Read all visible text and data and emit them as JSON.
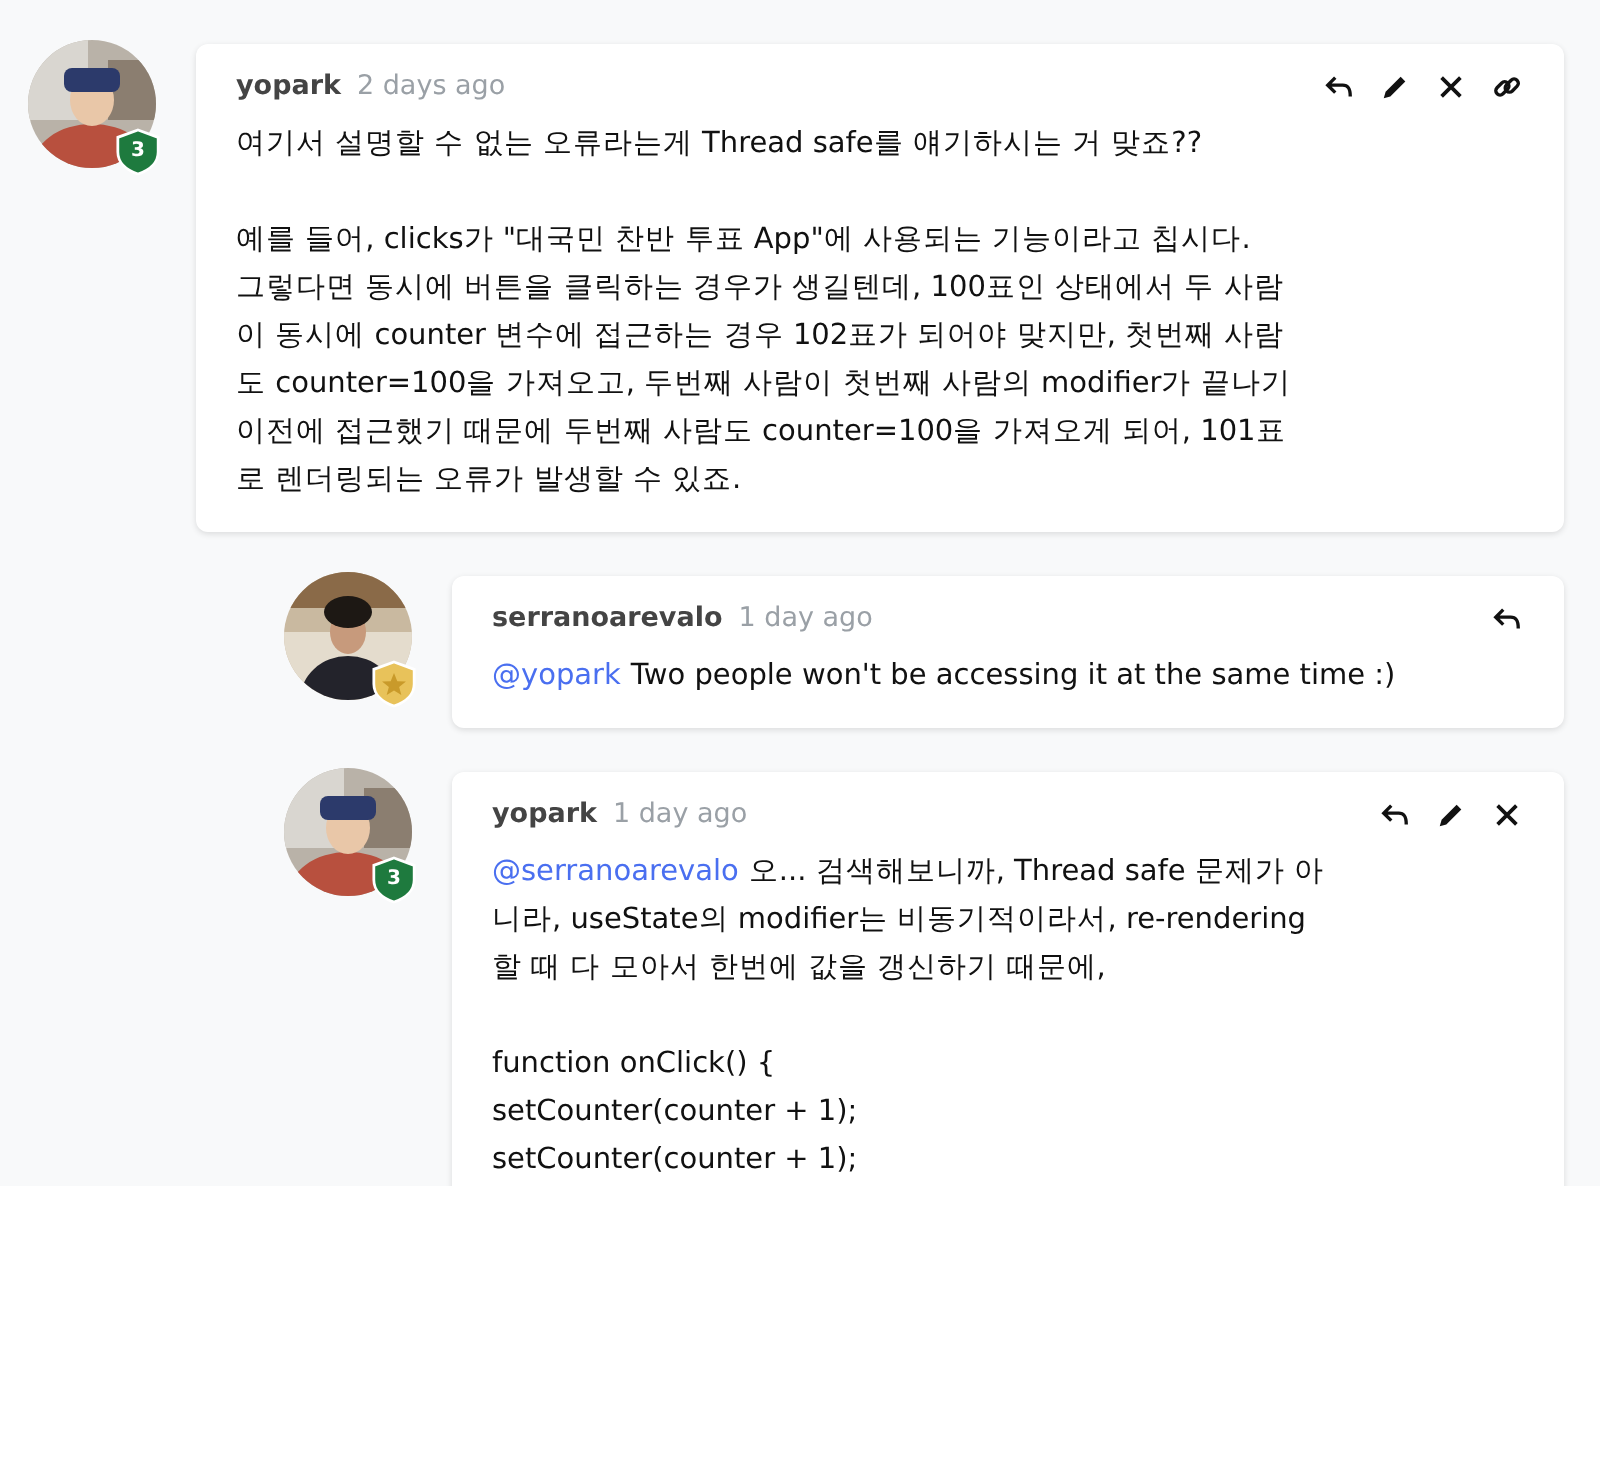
{
  "comments": [
    {
      "author": "yopark",
      "time": "2 days ago",
      "badge": {
        "kind": "shield",
        "label": "3"
      },
      "actions": [
        {
          "kind": "reply"
        },
        {
          "kind": "edit"
        },
        {
          "kind": "delete"
        },
        {
          "kind": "link"
        }
      ],
      "paragraphs": [
        [
          "여기서 설명할 수 없는 오류라는게 Thread safe를 얘기하시는 거 맞죠??"
        ],
        [
          "예를 들어, clicks가 \"대국민 찬반 투표 App\"에 사용되는 기능이라고 칩시다.",
          "그렇다면 동시에 버튼을 클릭하는 경우가 생길텐데, 100표인 상태에서 두 사람",
          "이 동시에 counter 변수에 접근하는 경우 102표가 되어야 맞지만, 첫번째 사람",
          "도 counter=100을 가져오고, 두번째 사람이 첫번째 사람의 modifier가 끝나기",
          "이전에 접근했기 때문에 두번째 사람도 counter=100을 가져오게 되어, 101표",
          "로 렌더링되는 오류가 발생할 수 있죠."
        ]
      ],
      "children": [
        {
          "author": "serranoarevalo",
          "time": "1 day ago",
          "badge": {
            "kind": "star"
          },
          "mention": "@yopark",
          "actions": [
            {
              "kind": "reply"
            }
          ],
          "paragraphs": [
            [
              "Two people won't be accessing it at the same time :)"
            ]
          ]
        },
        {
          "author": "yopark",
          "time": "1 day ago",
          "badge": {
            "kind": "shield",
            "label": "3"
          },
          "mention": "@serranoarevalo",
          "actions": [
            {
              "kind": "reply"
            },
            {
              "kind": "edit"
            },
            {
              "kind": "delete"
            }
          ],
          "paragraphs": [
            [
              "오... 검색해보니까, Thread safe 문제가 아",
              "니라, useState의 modifier는 비동기적이라서, re-rendering",
              "할 때 다 모아서 한번에 값을 갱신하기 때문에,"
            ],
            [
              "function onClick() {",
              "setCounter(counter + 1);",
              "setCounter(counter + 1);"
            ]
          ]
        }
      ]
    }
  ]
}
